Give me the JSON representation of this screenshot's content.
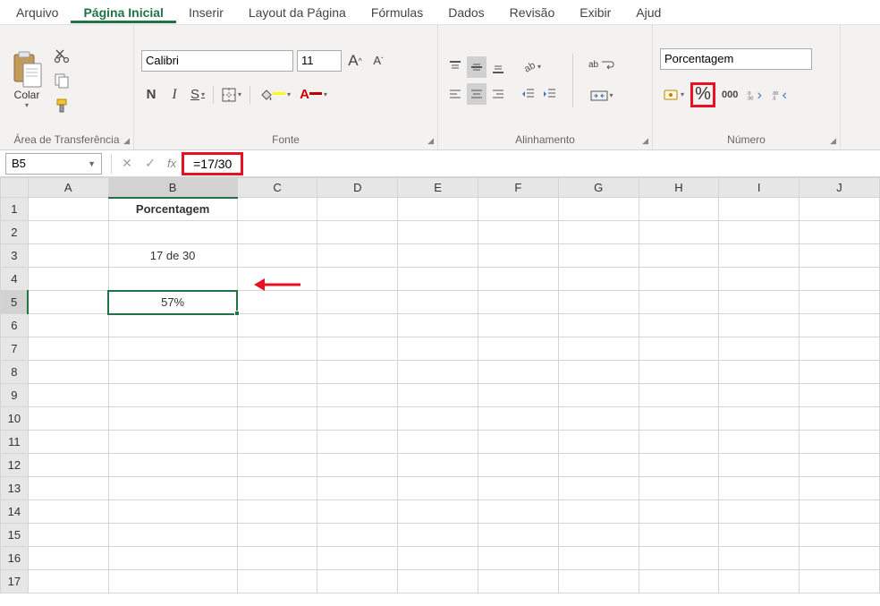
{
  "menu": {
    "items": [
      "Arquivo",
      "Página Inicial",
      "Inserir",
      "Layout da Página",
      "Fórmulas",
      "Dados",
      "Revisão",
      "Exibir",
      "Ajud"
    ],
    "active_index": 1
  },
  "ribbon": {
    "clipboard": {
      "paste_label": "Colar",
      "group_label": "Área de Transferência"
    },
    "font": {
      "name": "Calibri",
      "size": "11",
      "group_label": "Fonte",
      "bold": "N",
      "italic": "I",
      "underline": "S",
      "increase_a": "A",
      "decrease_a": "A"
    },
    "alignment": {
      "group_label": "Alinhamento",
      "wrap_ab": "ab"
    },
    "number": {
      "format": "Porcentagem",
      "group_label": "Número",
      "percent_symbol": "%",
      "comma_symbol": "000"
    }
  },
  "formula_bar": {
    "name_box": "B5",
    "fx": "fx",
    "formula": "=17/30"
  },
  "grid": {
    "columns": [
      "A",
      "B",
      "C",
      "D",
      "E",
      "F",
      "G",
      "H",
      "I",
      "J"
    ],
    "rows": 15,
    "active_col": "B",
    "active_row": 5,
    "cells": {
      "B1": {
        "value": "Porcentagem",
        "bold": true
      },
      "B3": {
        "value": "17 de 30"
      },
      "B5": {
        "value": "57%",
        "selected": true
      }
    }
  }
}
